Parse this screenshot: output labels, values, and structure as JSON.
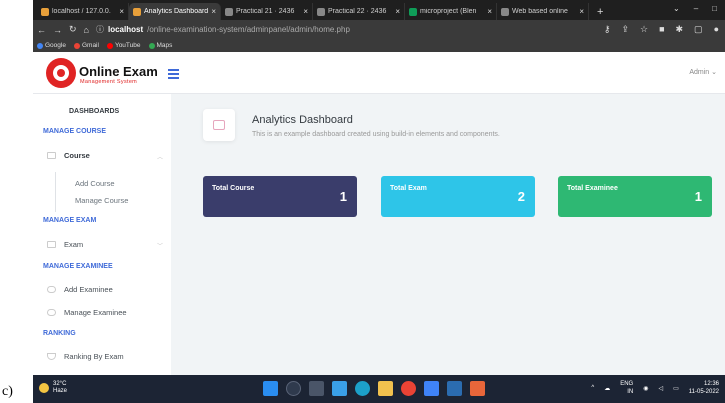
{
  "caption": "c)",
  "browser": {
    "tabs": [
      {
        "label": "localhost / 127.0.0.",
        "color": "#e8a03a",
        "active": false
      },
      {
        "label": "Analytics Dashboard",
        "color": "#e8a03a",
        "active": true
      },
      {
        "label": "Practical 21 · 2436",
        "color": "#888888",
        "active": false
      },
      {
        "label": "Practical 22 · 2436",
        "color": "#888888",
        "active": false
      },
      {
        "label": "microproject (Blen",
        "color": "#0f9d58",
        "active": false
      },
      {
        "label": "Web based online",
        "color": "#888888",
        "active": false
      }
    ],
    "close_glyph": "×",
    "newtab_glyph": "+",
    "url_host": "localhost",
    "url_path": "/online-examination-system/adminpanel/admin/home.php",
    "bookmarks": [
      {
        "label": "Google",
        "color": "#4285f4"
      },
      {
        "label": "Gmail",
        "color": "#ea4335"
      },
      {
        "label": "YouTube",
        "color": "#ff0000"
      },
      {
        "label": "Maps",
        "color": "#34a853"
      }
    ]
  },
  "header": {
    "brand_name": "Online Exam",
    "brand_sub": "Management System",
    "user_label": "Admin ⌄"
  },
  "sidebar": {
    "dashboards": "DASHBOARDS",
    "manage_course": "MANAGE COURSE",
    "course": "Course",
    "add_course": "Add Course",
    "manage_course_item": "Manage Course",
    "manage_exam": "MANAGE EXAM",
    "exam": "Exam",
    "manage_examinee": "MANAGE EXAMINEE",
    "add_examinee": "Add Examinee",
    "manage_examinee_item": "Manage Examinee",
    "ranking": "RANKING",
    "ranking_by_exam": "Ranking By Exam"
  },
  "main": {
    "title": "Analytics Dashboard",
    "subtitle": "This is an example dashboard created using build-in elements and components."
  },
  "cards": [
    {
      "label": "Total Course",
      "value": "1",
      "color": "#3a3d6b"
    },
    {
      "label": "Total Exam",
      "value": "2",
      "color": "#2ec5e8"
    },
    {
      "label": "Total Examinee",
      "value": "1",
      "color": "#2eb873"
    }
  ],
  "taskbar": {
    "temp": "32°C",
    "weather": "Haze",
    "lang1": "ENG",
    "lang2": "IN",
    "time": "12:36",
    "date": "11-05-2022"
  }
}
